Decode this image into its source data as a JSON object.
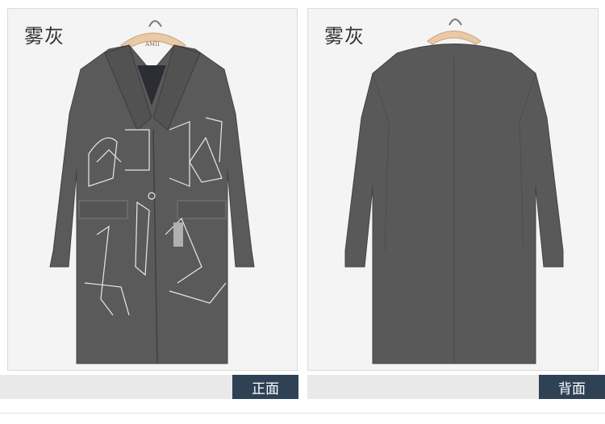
{
  "panels": {
    "front": {
      "color_name": "雾灰",
      "view_label": "正面"
    },
    "back": {
      "color_name": "雾灰",
      "view_label": "背面"
    }
  },
  "hanger_brand": "AMII",
  "colors": {
    "coat": "#5a5a5a",
    "coat_dark": "#4a4a4a",
    "hanger": "#e9c9a6",
    "tag_bg": "#2f4255"
  }
}
